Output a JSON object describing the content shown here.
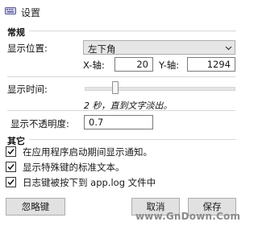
{
  "window": {
    "title": "设置"
  },
  "groups": {
    "general": "常规",
    "other": "其它"
  },
  "position": {
    "label": "显示位置:",
    "selected": "左下角",
    "x_label": "X-轴:",
    "x_value": "20",
    "y_label": "Y-轴:",
    "y_value": "1294"
  },
  "display_time": {
    "label": "显示时间:",
    "slider_fraction": 0.2,
    "note": "2 秒，直到文字淡出。"
  },
  "opacity": {
    "label": "显示不透明度:",
    "value": "0.7"
  },
  "options": [
    {
      "label": "在应用程序启动期间显示通知。",
      "checked": true
    },
    {
      "label": "显示特殊键的标准文本。",
      "checked": true
    },
    {
      "label": "日志键被按下到 app.log 文件中",
      "checked": true
    }
  ],
  "buttons": {
    "ignore": "忽略键",
    "cancel": "取消",
    "save": "保存"
  },
  "watermark": "www.GnDown.Com"
}
